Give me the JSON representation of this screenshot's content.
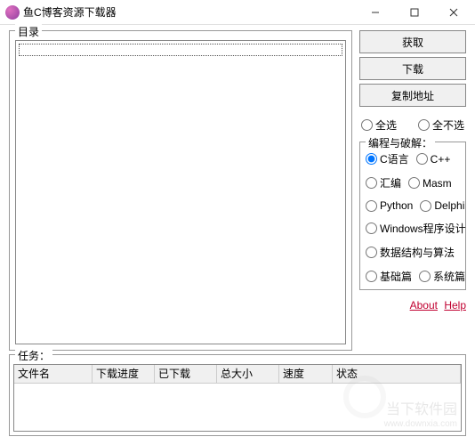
{
  "window": {
    "title": "鱼C博客资源下载器"
  },
  "dir": {
    "label": "目录"
  },
  "buttons": {
    "fetch": "获取",
    "download": "下载",
    "copy": "复制地址"
  },
  "select": {
    "all": "全选",
    "none": "全不选"
  },
  "categories": {
    "label": "编程与破解：",
    "items": {
      "c": "C语言",
      "cpp": "C++",
      "asm": "汇编",
      "masm": "Masm",
      "python": "Python",
      "delphi": "Delphi",
      "win": "Windows程序设计",
      "ds": "数据结构与算法",
      "basic": "基础篇",
      "sys": "系统篇"
    },
    "selected": "c"
  },
  "links": {
    "about": "About",
    "help": "Help"
  },
  "tasks": {
    "label": "任务：",
    "cols": {
      "name": "文件名",
      "progress": "下载进度",
      "done": "已下载",
      "total": "总大小",
      "speed": "速度",
      "status": "状态"
    }
  },
  "watermark": {
    "text": "当下软件园",
    "url": "www.downxia.com"
  }
}
